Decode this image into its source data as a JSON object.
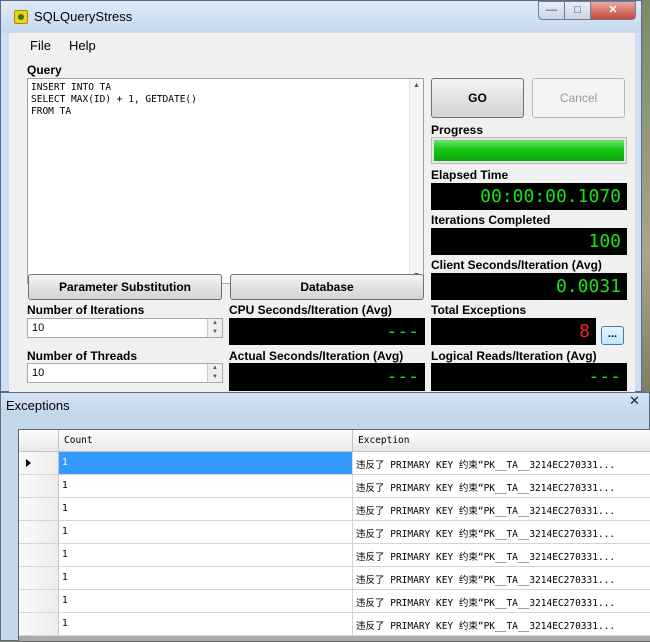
{
  "main_window": {
    "title": "SQLQueryStress",
    "min_glyph": "—",
    "max_glyph": "□",
    "close_glyph": "✕"
  },
  "menu": [
    "File",
    "Help"
  ],
  "query": {
    "label": "Query",
    "text": "INSERT INTO TA\nSELECT MAX(ID) + 1, GETDATE()\nFROM TA"
  },
  "buttons": {
    "go": "GO",
    "cancel": "Cancel",
    "parameter_substitution": "Parameter Substitution",
    "database": "Database",
    "ellipsis": "..."
  },
  "progress": {
    "label": "Progress",
    "fraction": 1.0
  },
  "elapsed_time": {
    "label": "Elapsed Time",
    "value": "00:00:00.1070"
  },
  "iterations_completed": {
    "label": "Iterations Completed",
    "value": "100"
  },
  "client_seconds": {
    "label": "Client Seconds/Iteration (Avg)",
    "value": "0.0031"
  },
  "cpu_seconds": {
    "label": "CPU Seconds/Iteration (Avg)",
    "value": "---"
  },
  "total_exceptions": {
    "label": "Total Exceptions",
    "value": "8"
  },
  "actual_seconds": {
    "label": "Actual Seconds/Iteration (Avg)",
    "value": "---"
  },
  "logical_reads": {
    "label": "Logical Reads/Iteration (Avg)",
    "value": "---"
  },
  "iterations": {
    "label": "Number of Iterations",
    "value": "10"
  },
  "threads": {
    "label": "Number of Threads",
    "value": "10"
  },
  "exceptions_window": {
    "title": "Exceptions",
    "close_glyph": "✕",
    "columns": [
      "Count",
      "Exception"
    ],
    "rows": [
      {
        "count": "1",
        "exception": "违反了 PRIMARY KEY 约束“PK__TA__3214EC270331..."
      },
      {
        "count": "1",
        "exception": "违反了 PRIMARY KEY 约束“PK__TA__3214EC270331..."
      },
      {
        "count": "1",
        "exception": "违反了 PRIMARY KEY 约束“PK__TA__3214EC270331..."
      },
      {
        "count": "1",
        "exception": "违反了 PRIMARY KEY 约束“PK__TA__3214EC270331..."
      },
      {
        "count": "1",
        "exception": "违反了 PRIMARY KEY 约束“PK__TA__3214EC270331..."
      },
      {
        "count": "1",
        "exception": "违反了 PRIMARY KEY 约束“PK__TA__3214EC270331..."
      },
      {
        "count": "1",
        "exception": "违反了 PRIMARY KEY 约束“PK__TA__3214EC270331..."
      },
      {
        "count": "1",
        "exception": "违反了 PRIMARY KEY 约束“PK__TA__3214EC270331..."
      }
    ]
  },
  "colors": {
    "lcd_green": "#16e316",
    "lcd_red": "#ff2020",
    "progress_green": "#15c615",
    "selection_blue": "#3399ff"
  }
}
